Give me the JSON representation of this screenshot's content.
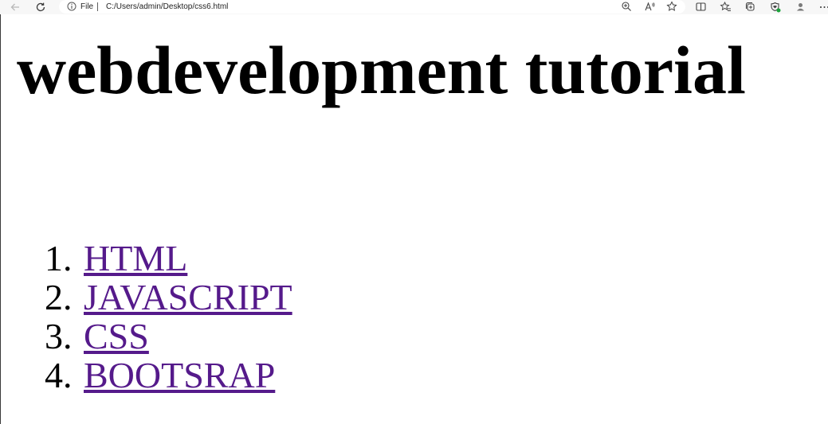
{
  "browser": {
    "address_scheme": "File",
    "url": "C:/Users/admin/Desktop/css6.html"
  },
  "page": {
    "heading": "webdevelopment tutorial",
    "list": [
      {
        "number": "1.",
        "label": "HTML"
      },
      {
        "number": "2.",
        "label": "JAVASCRIPT"
      },
      {
        "number": "3.",
        "label": "CSS"
      },
      {
        "number": "4.",
        "label": "BOOTSRAP"
      }
    ]
  },
  "colors": {
    "link_visited": "#551a8b",
    "heading": "#000000",
    "toolbar_bg": "#f7f7f7"
  }
}
